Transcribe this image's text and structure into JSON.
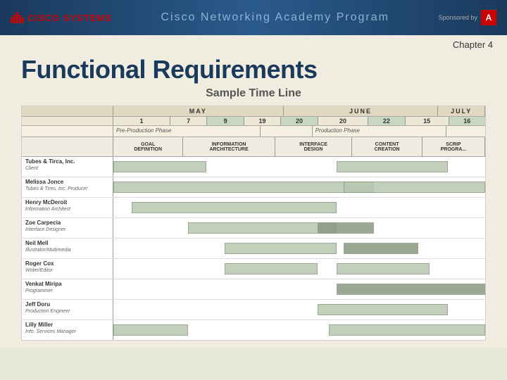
{
  "header": {
    "cisco_label": "CISCO SYSTEMS",
    "academy_title": "Cisco Networking Academy Program",
    "sponsored_label": "Sponsored by",
    "adobe_label": "Adobe"
  },
  "chapter": {
    "label": "Chapter 4"
  },
  "page": {
    "title": "Functional Requirements",
    "subtitle": "Sample Time Line"
  },
  "months": [
    "MAY",
    "JUNE",
    "JULY"
  ],
  "phases": {
    "pre_prod": "Pre-Production Phase",
    "prod": "Production Phase"
  },
  "phase_cols": [
    "GOAL\nDEFINITION",
    "INFORMATION\nARCHITECTURE",
    "INTERFACE\nDESIGN",
    "CONTENT\nCREATION",
    "SCRIPTING\nPROGRA..."
  ],
  "team_rows": [
    {
      "name": "Tubes & Tirca, Inc.",
      "role": "Client"
    },
    {
      "name": "Melissa Jonce",
      "role": "Tubes & Tires, Inc. Producer"
    },
    {
      "name": "Henry McDeroit",
      "role": "Information Architect"
    },
    {
      "name": "Zoe Carpecia",
      "role": "Interface Designer"
    },
    {
      "name": "Neil Mell",
      "role": "Illustrator/Multimedia"
    },
    {
      "name": "Roger Cox",
      "role": "Writer/Editor"
    },
    {
      "name": "Venkat Miripa",
      "role": "Programmer"
    },
    {
      "name": "Jeff Doru",
      "role": "Production Engineer"
    },
    {
      "name": "Lilly Miller",
      "role": "Info. Services Manager"
    }
  ],
  "colors": {
    "header_bg": "#1a3a5c",
    "title_color": "#1a3a5c",
    "accent": "#cc0000",
    "bar_color": "#b8c8b0",
    "bar_dark": "#8a9a82"
  }
}
